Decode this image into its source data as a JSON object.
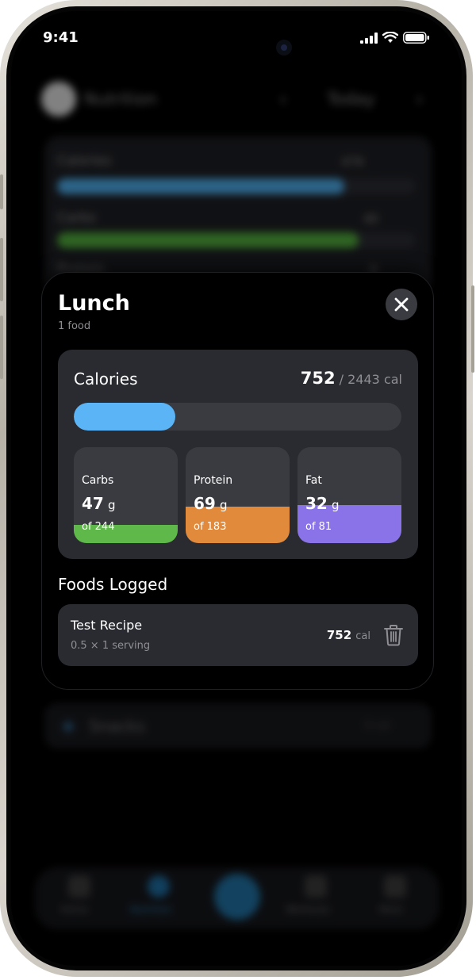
{
  "status_bar": {
    "time": "9:41"
  },
  "background": {
    "header": {
      "title": "Nutrition",
      "date": "Today"
    },
    "summary": [
      {
        "label": "Calories",
        "value": "476",
        "color": "#4ba7e3",
        "progress": 0.8
      },
      {
        "label": "Carbs",
        "value": "40",
        "color": "#4ea63a",
        "progress": 0.84
      },
      {
        "label": "Protein",
        "value": "8"
      }
    ],
    "snacks": {
      "label": "Snacks",
      "meta": "0 cal"
    },
    "tabs": [
      {
        "label": "Home"
      },
      {
        "label": "Nutrition"
      },
      {
        "label": "Workouts"
      },
      {
        "label": "More"
      }
    ]
  },
  "modal": {
    "title": "Lunch",
    "subtitle": "1 food",
    "close_icon": "close-icon",
    "calories": {
      "label": "Calories",
      "current": "752",
      "separator": "/",
      "goal": "2443",
      "unit": "cal",
      "progress": 0.31,
      "color": "#5ab4f6"
    },
    "macros": [
      {
        "label": "Carbs",
        "amount": "47",
        "unit": "g",
        "goal": "of 244",
        "fill": 0.19,
        "color": "#5fb84a"
      },
      {
        "label": "Protein",
        "amount": "69",
        "unit": "g",
        "goal": "of 183",
        "fill": 0.38,
        "color": "#e18a3b"
      },
      {
        "label": "Fat",
        "amount": "32",
        "unit": "g",
        "goal": "of 81",
        "fill": 0.4,
        "color": "#8a73e8"
      }
    ],
    "foods_title": "Foods Logged",
    "foods": [
      {
        "name": "Test Recipe",
        "serving": "0.5 × 1 serving",
        "calories": "752",
        "unit": "cal",
        "icon": "trash-icon"
      }
    ]
  }
}
